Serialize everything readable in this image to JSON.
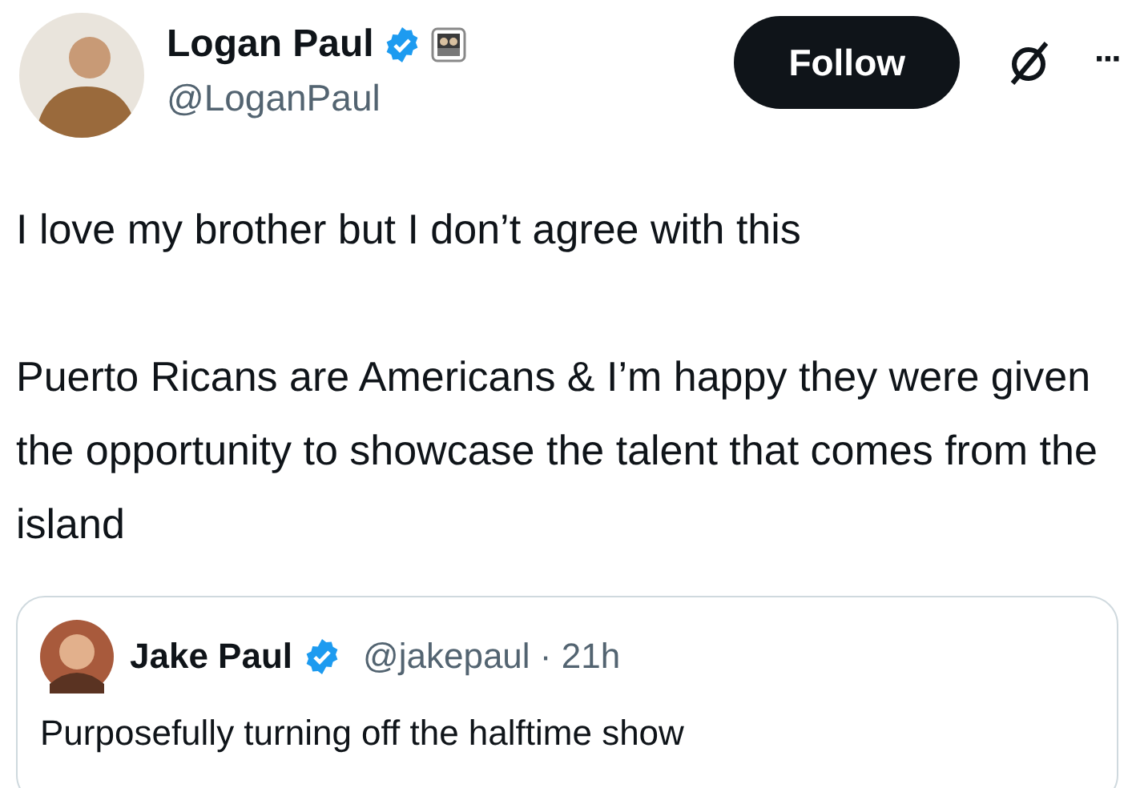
{
  "author": {
    "name": "Logan Paul",
    "handle": "@LoganPaul",
    "verified": true,
    "affiliate": true
  },
  "follow_button": {
    "label": "Follow"
  },
  "more_button": {
    "label": "···"
  },
  "body": [
    "I love my brother but I don’t agree with this",
    "Puerto Ricans are Americans & I’m happy they were given the opportunity to showcase the talent that comes from the island"
  ],
  "quoted_post": {
    "name": "Jake Paul",
    "verified": true,
    "meta": "@jakepaul · 21h",
    "text": "Purposefully turning off the halftime show"
  }
}
